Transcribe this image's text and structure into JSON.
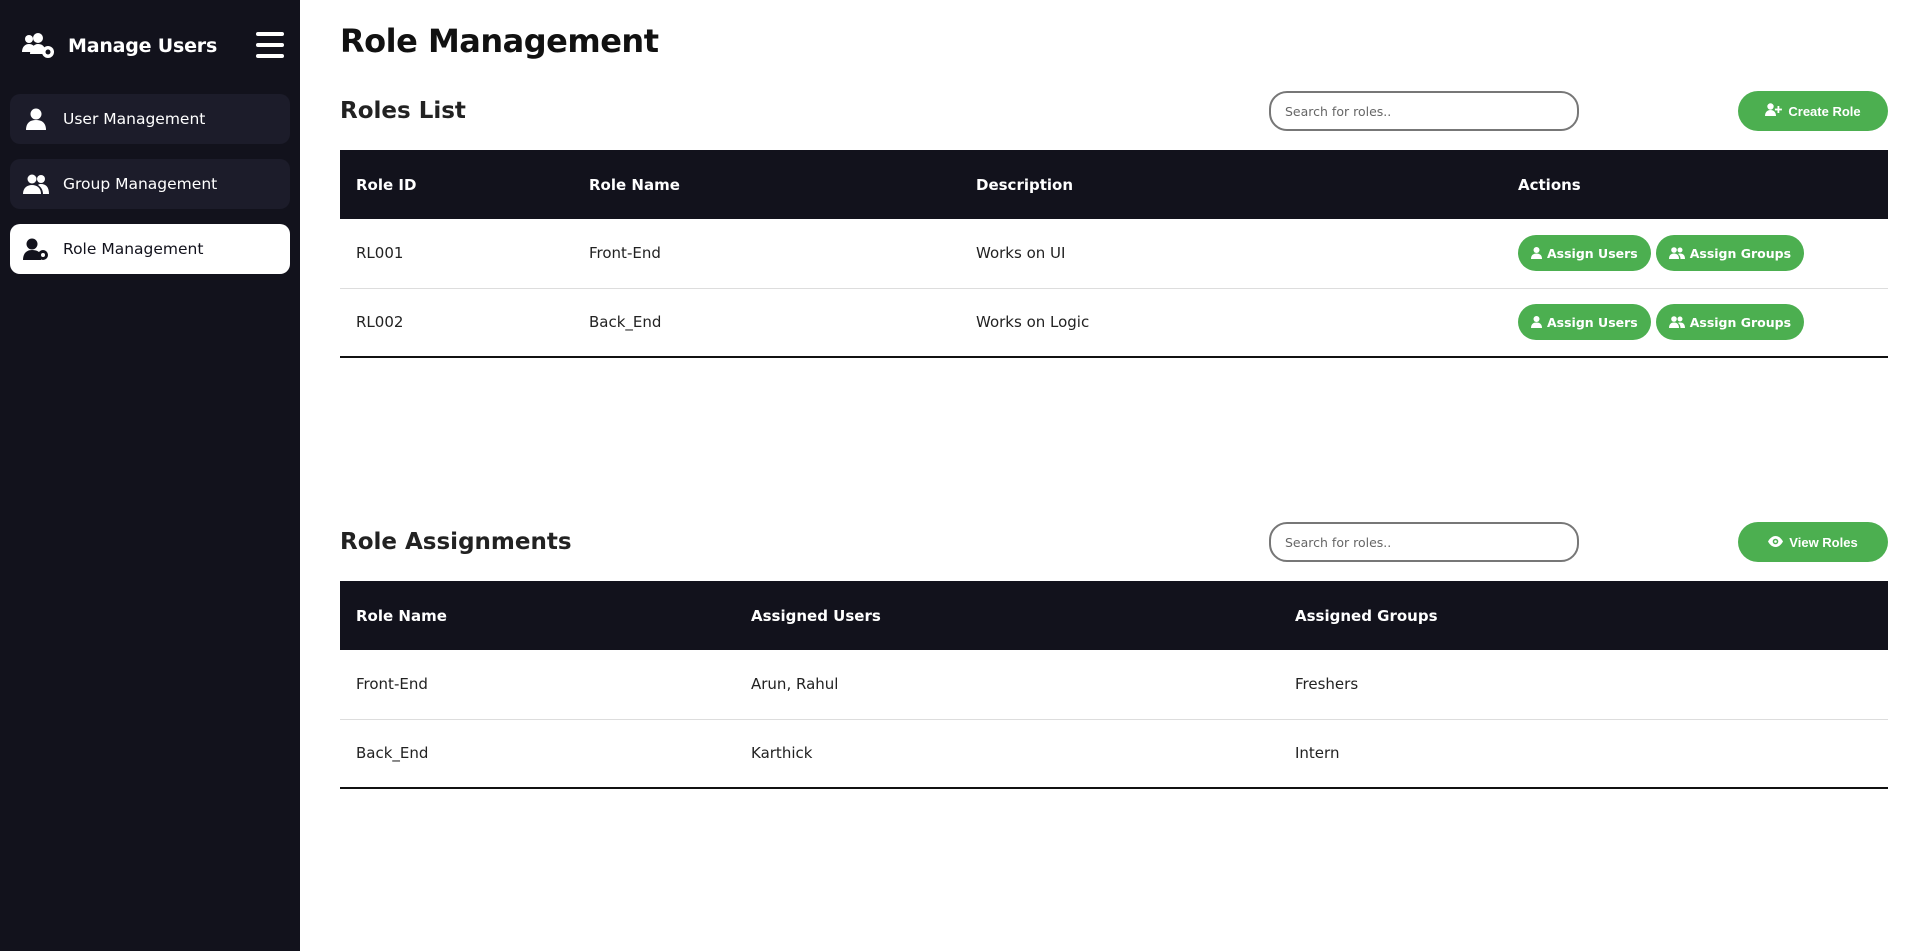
{
  "sidebar": {
    "title": "Manage Users",
    "brand_icon": "users-cog-icon",
    "menu_icon": "hamburger-icon",
    "items": [
      {
        "label": "User Management",
        "icon": "user-icon",
        "active": false
      },
      {
        "label": "Group Management",
        "icon": "users-icon",
        "active": false
      },
      {
        "label": "Role Management",
        "icon": "user-gear-icon",
        "active": true
      }
    ]
  },
  "page": {
    "title": "Role Management"
  },
  "roles_list": {
    "title": "Roles List",
    "search_placeholder": "Search for roles..",
    "create_label": "Create Role",
    "columns": [
      "Role ID",
      "Role Name",
      "Description",
      "Actions"
    ],
    "rows": [
      {
        "id": "RL001",
        "name": "Front-End",
        "description": "Works on UI"
      },
      {
        "id": "RL002",
        "name": "Back_End",
        "description": "Works on Logic"
      }
    ],
    "assign_users_label": "Assign Users",
    "assign_groups_label": "Assign Groups"
  },
  "role_assignments": {
    "title": "Role Assignments",
    "search_placeholder": "Search for roles..",
    "view_label": "View Roles",
    "columns": [
      "Role Name",
      "Assigned Users",
      "Assigned Groups"
    ],
    "rows": [
      {
        "name": "Front-End",
        "users": "Arun, Rahul",
        "groups": "Freshers"
      },
      {
        "name": "Back_End",
        "users": "Karthick",
        "groups": "Intern"
      }
    ]
  },
  "colors": {
    "sidebar_bg": "#12121c",
    "accent_green": "#4caf50",
    "header_bg": "#12121c"
  }
}
